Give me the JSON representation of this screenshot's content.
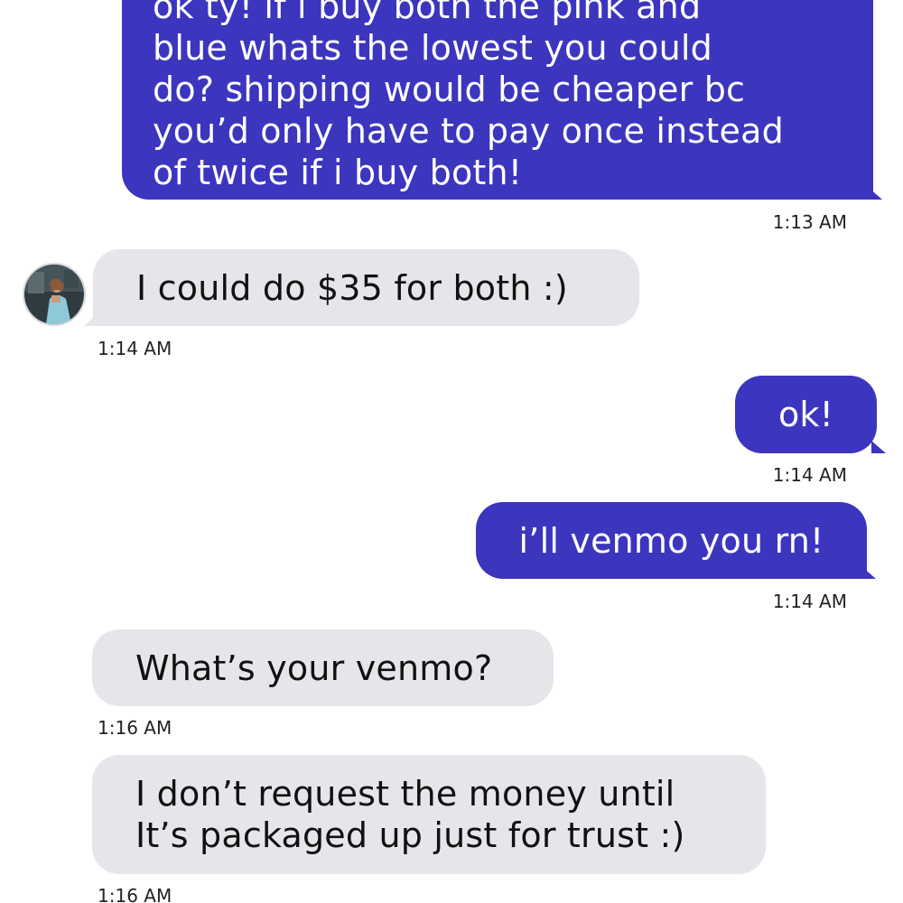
{
  "conversation": {
    "messages": [
      {
        "direction": "sent",
        "lines": [
          "ok ty! if i buy both the pink and",
          "blue whats the lowest you could",
          "do? shipping would be cheaper bc",
          "you’d only have to pay once instead",
          "of twice if i buy both!"
        ],
        "time": "1:13 AM"
      },
      {
        "direction": "received",
        "lines": [
          "I could do $35 for both :)"
        ],
        "time": "1:14 AM"
      },
      {
        "direction": "sent",
        "lines": [
          "ok!"
        ],
        "time": "1:14 AM"
      },
      {
        "direction": "sent",
        "lines": [
          "i’ll venmo you rn!"
        ],
        "time": "1:14 AM"
      },
      {
        "direction": "received",
        "lines": [
          "What’s your venmo?"
        ],
        "time": "1:16 AM"
      },
      {
        "direction": "received",
        "lines": [
          "I don’t request the money until",
          "It’s packaged up just for trust :)"
        ],
        "time": "1:16 AM"
      }
    ]
  },
  "colors": {
    "sent_bubble": "#3c35be",
    "received_bubble": "#e6e6ea",
    "background": "#ffffff"
  },
  "icons": {
    "contact_avatar": "avatar"
  }
}
